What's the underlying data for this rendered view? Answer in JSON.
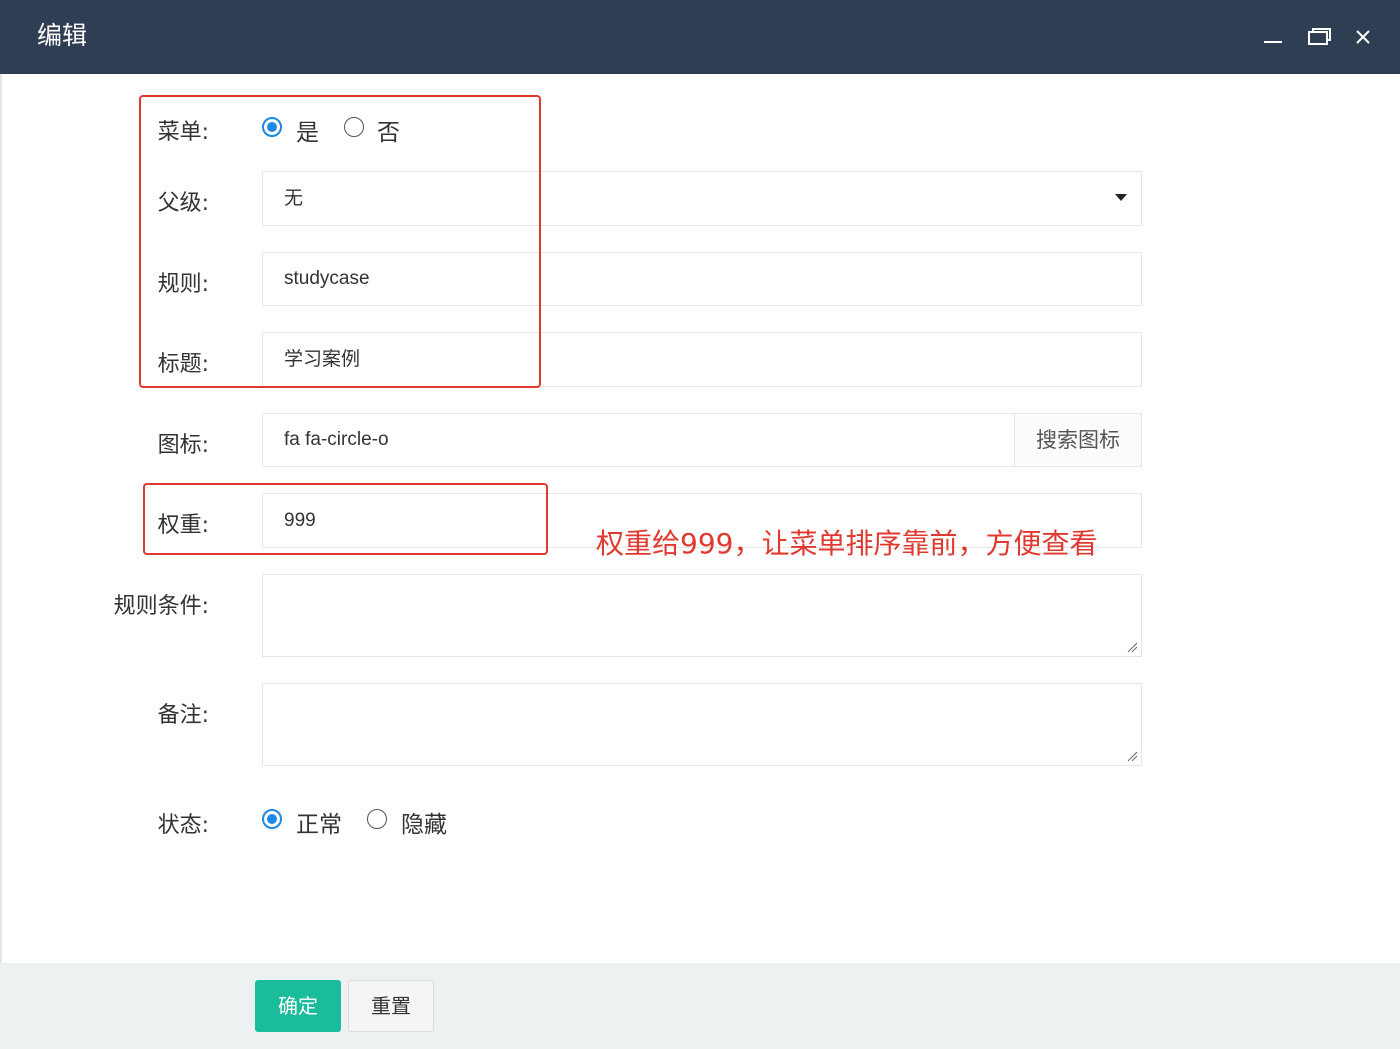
{
  "window": {
    "title": "编辑",
    "minimize_icon": "minimize-icon",
    "maximize_icon": "maximize-icon",
    "close_icon": "close-icon",
    "titlebar_color": "#2f3e52"
  },
  "form": {
    "menu": {
      "label": "菜单:",
      "options": [
        "是",
        "否"
      ],
      "selected": "是"
    },
    "parent": {
      "label": "父级:",
      "value": "无"
    },
    "rule": {
      "label": "规则:",
      "value": "studycase"
    },
    "title": {
      "label": "标题:",
      "value": "学习案例"
    },
    "icon": {
      "label": "图标:",
      "value": "fa fa-circle-o",
      "addon": "搜索图标"
    },
    "weight": {
      "label": "权重:",
      "value": "999"
    },
    "condition": {
      "label": "规则条件:",
      "value": ""
    },
    "remark": {
      "label": "备注:",
      "value": ""
    },
    "status": {
      "label": "状态:",
      "options": [
        "正常",
        "隐藏"
      ],
      "selected": "正常"
    }
  },
  "annotation": {
    "text": "权重给999，让菜单排序靠前，方便查看",
    "color": "#e0392f"
  },
  "footer": {
    "confirm": "确定",
    "reset": "重置",
    "primary_color": "#1abc9c"
  }
}
